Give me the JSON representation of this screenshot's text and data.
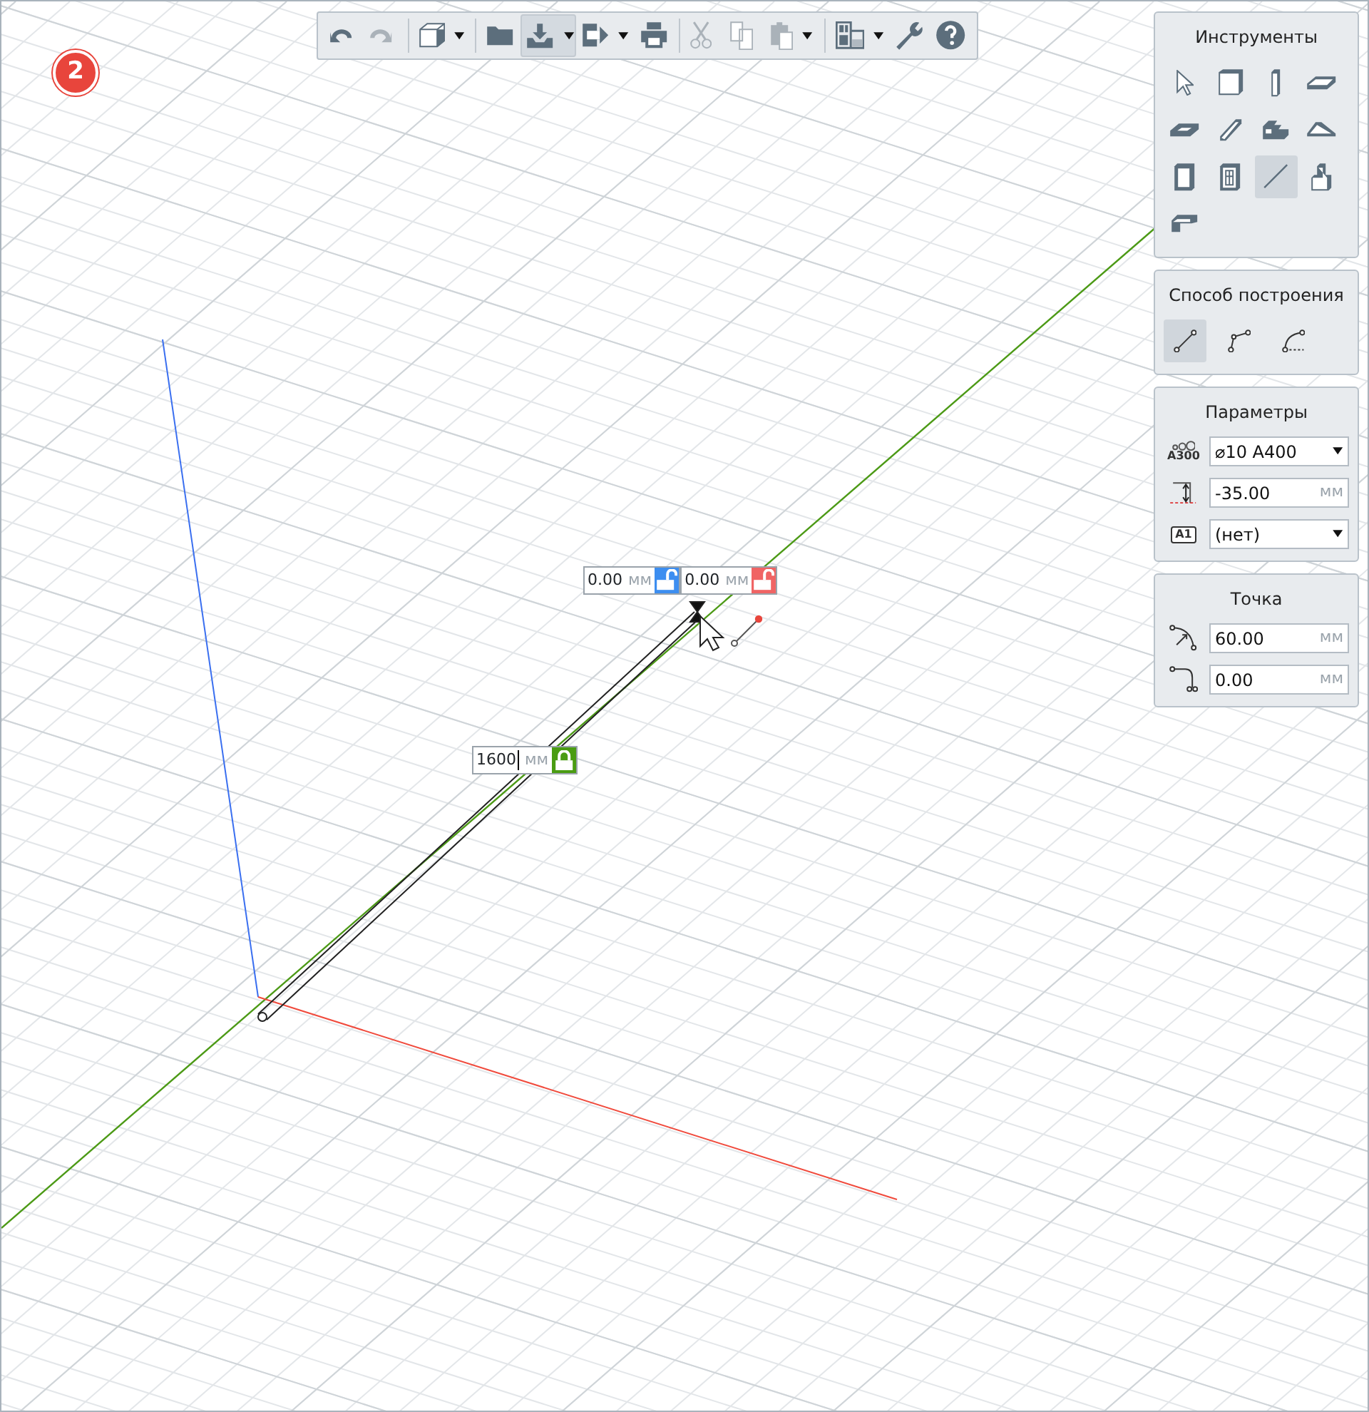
{
  "step_badge": "2",
  "toolbar": [
    {
      "kind": "button",
      "disabled": false,
      "selected": false,
      "dropdown": false
    },
    {
      "kind": "button",
      "disabled": true,
      "selected": false,
      "dropdown": false
    },
    {
      "kind": "separator"
    },
    {
      "kind": "button",
      "disabled": false,
      "selected": false,
      "dropdown": true
    },
    {
      "kind": "separator"
    },
    {
      "kind": "button",
      "disabled": false,
      "selected": false,
      "dropdown": false
    },
    {
      "kind": "button",
      "disabled": false,
      "selected": true,
      "dropdown": true
    },
    {
      "kind": "button",
      "disabled": false,
      "selected": false,
      "dropdown": true
    },
    {
      "kind": "button",
      "disabled": false,
      "selected": false,
      "dropdown": false
    },
    {
      "kind": "separator"
    },
    {
      "kind": "button",
      "disabled": true,
      "selected": false,
      "dropdown": false
    },
    {
      "kind": "button",
      "disabled": true,
      "selected": false,
      "dropdown": false
    },
    {
      "kind": "button",
      "disabled": true,
      "selected": false,
      "dropdown": true
    },
    {
      "kind": "separator"
    },
    {
      "kind": "button",
      "disabled": false,
      "selected": false,
      "dropdown": true
    },
    {
      "kind": "button",
      "disabled": false,
      "selected": false,
      "dropdown": false
    },
    {
      "kind": "button",
      "disabled": false,
      "selected": false,
      "dropdown": false
    }
  ],
  "tools_panel": {
    "title": "Инструменты",
    "tools": [
      {
        "selected": false
      },
      {
        "selected": false
      },
      {
        "selected": false
      },
      {
        "selected": false
      },
      {
        "selected": false
      },
      {
        "selected": false
      },
      {
        "selected": false
      },
      {
        "selected": false
      },
      {
        "selected": false
      },
      {
        "selected": false
      },
      {
        "selected": true
      },
      {
        "selected": false
      },
      {
        "selected": false
      }
    ]
  },
  "method_panel": {
    "title": "Способ построения",
    "options": [
      {
        "selected": true
      },
      {
        "selected": false
      },
      {
        "selected": false
      }
    ]
  },
  "parameters_panel": {
    "title": "Параметры",
    "fields": [
      {
        "kind": "select",
        "icon_text": "A300",
        "value": "⌀10 A400"
      },
      {
        "kind": "input",
        "value": "-35.00",
        "unit": "мм"
      },
      {
        "kind": "select",
        "icon_text": "A1",
        "value": "(нет)"
      }
    ]
  },
  "point_panel": {
    "title": "Точка",
    "fields": [
      {
        "kind": "input",
        "value": "60.00",
        "unit": "мм"
      },
      {
        "kind": "input",
        "value": "0.00",
        "unit": "мм"
      }
    ]
  },
  "viewport": {
    "dimension_inputs": [
      {
        "value": "0.00",
        "unit": "мм",
        "locked": false,
        "color": "#3d8ef0",
        "caret": false
      },
      {
        "value": "0.00",
        "unit": "мм",
        "locked": false,
        "color": "#f06464",
        "caret": false
      },
      {
        "value": "1600",
        "unit": "мм",
        "locked": true,
        "color": "#4a9c12",
        "caret": true
      }
    ]
  }
}
